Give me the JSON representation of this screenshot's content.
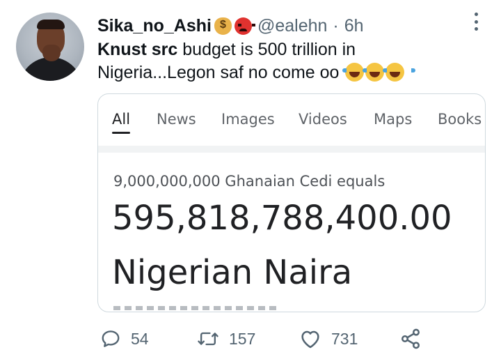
{
  "tweet": {
    "author_name": "Sika_no_Ashi",
    "author_emojis": [
      "money-bag",
      "angry-face"
    ],
    "handle": "@ealehn",
    "separator": "·",
    "time": "6h",
    "text_bold": "Knust src",
    "text_line1_rest": " budget is 500 trillion in",
    "text_line2": "Nigeria...Legon saf no come oo",
    "text_emojis": [
      "tears-of-joy",
      "tears-of-joy",
      "tears-of-joy"
    ]
  },
  "search_card": {
    "tabs": [
      "All",
      "News",
      "Images",
      "Videos",
      "Maps",
      "Books"
    ],
    "active_tab": "All",
    "conversion_label": "9,000,000,000 Ghanaian Cedi equals",
    "conversion_value": "595,818,788,400.00",
    "conversion_currency": "Nigerian Naira"
  },
  "actions": {
    "replies": "54",
    "retweets": "157",
    "likes": "731"
  },
  "colors": {
    "text": "#0f1419",
    "muted": "#536471",
    "card_border": "#cfd9de",
    "google_text": "#202124"
  }
}
